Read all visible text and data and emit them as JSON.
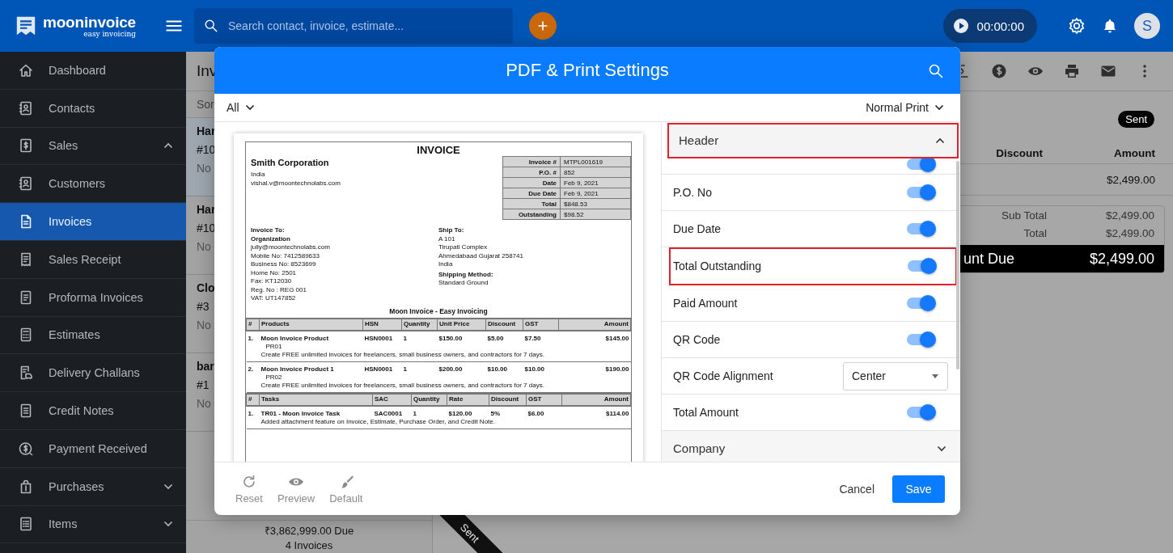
{
  "topbar": {
    "logo_name": "mooninvoice",
    "logo_tagline": "easy invoicing",
    "search_placeholder": "Search contact, invoice, estimate...",
    "timer": "00:00:00",
    "avatar": "S"
  },
  "sidebar": {
    "items": [
      {
        "kind": "link",
        "label": "Dashboard",
        "selected": false
      },
      {
        "kind": "link",
        "label": "Contacts",
        "selected": false
      },
      {
        "kind": "group",
        "label": "Sales",
        "selected": false,
        "expanded": true
      },
      {
        "kind": "link",
        "label": "Customers",
        "selected": false
      },
      {
        "kind": "link",
        "label": "Invoices",
        "selected": true
      },
      {
        "kind": "link",
        "label": "Sales Receipt",
        "selected": false
      },
      {
        "kind": "link",
        "label": "Proforma Invoices",
        "selected": false
      },
      {
        "kind": "link",
        "label": "Estimates",
        "selected": false
      },
      {
        "kind": "link",
        "label": "Delivery Challans",
        "selected": false
      },
      {
        "kind": "link",
        "label": "Credit Notes",
        "selected": false
      },
      {
        "kind": "link",
        "label": "Payment Received",
        "selected": false
      },
      {
        "kind": "group",
        "label": "Purchases",
        "selected": false,
        "expanded": false
      },
      {
        "kind": "group",
        "label": "Items",
        "selected": false,
        "expanded": false
      }
    ]
  },
  "list": {
    "title": "Inv",
    "sort": "Sor",
    "items": [
      {
        "name": "Har",
        "number": "#10",
        "status": "No",
        "selected": true
      },
      {
        "name": "Har",
        "number": "#10",
        "status": "No",
        "selected": false
      },
      {
        "name": "Clo",
        "number": "#3",
        "status": "No",
        "selected": false
      },
      {
        "name": "bar",
        "number": "#1",
        "status": "No",
        "selected": false
      }
    ],
    "total_due": "₹3,862,999.00 Due",
    "count": "4 Invoices"
  },
  "detail": {
    "status_badge": "Sent",
    "columns": [
      "Discount",
      "Amount"
    ],
    "row": [
      "$2,499.00"
    ],
    "totals": [
      {
        "label": "Sub Total",
        "value": "$2,499.00"
      },
      {
        "label": "Total",
        "value": "$2,499.00"
      }
    ],
    "amount_due": {
      "label": "unt Due",
      "value": "$2,499.00"
    },
    "ribbon": "Sent"
  },
  "modal": {
    "title": "PDF & Print Settings",
    "filter": "All",
    "print_mode": "Normal Print",
    "sections": [
      {
        "title": "Header",
        "expanded": true,
        "highlighted": true,
        "rows": [
          {
            "kind": "partial",
            "on": true
          },
          {
            "kind": "toggle",
            "label": "P.O. No",
            "on": true,
            "highlighted": false
          },
          {
            "kind": "toggle",
            "label": "Due Date",
            "on": true,
            "highlighted": false
          },
          {
            "kind": "toggle",
            "label": "Total Outstanding",
            "on": true,
            "highlighted": true
          },
          {
            "kind": "toggle",
            "label": "Paid Amount",
            "on": true,
            "highlighted": false
          },
          {
            "kind": "toggle",
            "label": "QR Code",
            "on": true,
            "highlighted": false
          },
          {
            "kind": "select",
            "label": "QR Code Alignment",
            "value": "Center",
            "highlighted": false
          },
          {
            "kind": "toggle",
            "label": "Total Amount",
            "on": true,
            "highlighted": false
          }
        ]
      },
      {
        "title": "Company",
        "expanded": false,
        "highlighted": false
      }
    ],
    "tools": [
      "Reset",
      "Preview",
      "Default"
    ],
    "cancel": "Cancel",
    "save": "Save"
  },
  "preview": {
    "title": "INVOICE",
    "company": "Smith Corporation",
    "company_lines": [
      "India",
      "vishal.v@moontechnolabs.com"
    ],
    "meta": [
      {
        "label": "Invoice #",
        "value": "MTPL001619"
      },
      {
        "label": "P.O. #",
        "value": "852"
      },
      {
        "label": "Date",
        "value": "Feb 9, 2021"
      },
      {
        "label": "Due Date",
        "value": "Feb 9, 2021"
      },
      {
        "label": "Total",
        "value": "$848.53"
      },
      {
        "label": "Outstanding",
        "value": "$98.52"
      }
    ],
    "bill_to": {
      "heading": "Invoice To:",
      "name": "Organization",
      "lines": [
        "jully@moontechnolabs.com",
        "Mobile No: 7412589633",
        "Business No: 8523699",
        "Home No: 2501",
        "Fax: KT12030",
        "Reg. No : REG 001",
        "VAT: UT147852"
      ]
    },
    "ship_to": {
      "heading": "Ship To:",
      "lines": [
        "A 101",
        "Tirupati Complex",
        "Ahmedabaad Gujarat 258741",
        "India"
      ],
      "method_heading": "Shipping Method:",
      "method": "Standard Ground"
    },
    "tagline": "Moon Invoice - Easy Invoicing",
    "products": {
      "columns": [
        "#",
        "Products",
        "HSN",
        "Quantity",
        "Unit Price",
        "Discount",
        "GST",
        "Amount"
      ],
      "rows": [
        {
          "cells": [
            "1.",
            "Moon Invoice Product",
            "HSN0001",
            "1",
            "$150.00",
            "$5.00",
            "$7.50",
            "$145.00"
          ],
          "code": "PR01",
          "description": "Create FREE unlimited invoices for freelancers, small business owners, and contractors for 7 days."
        },
        {
          "cells": [
            "2.",
            "Moon Invoice Product 1",
            "HSN0001",
            "1",
            "$200.00",
            "$10.00",
            "$10.00",
            "$190.00"
          ],
          "code": "PR02",
          "description": "Create FREE unlimited invoices for freelancers, small business owners, and contractors for 7 days."
        }
      ]
    },
    "tasks": {
      "columns": [
        "#",
        "Tasks",
        "SAC",
        "Quantity",
        "Rate",
        "Discount",
        "GST",
        "Amount"
      ],
      "rows": [
        {
          "cells": [
            "1.",
            "TR01 - Moon Invoice Task",
            "SAC0001",
            "1",
            "$120.00",
            "5%",
            "$6.00",
            "$114.00"
          ],
          "description": "Added attachment feature on Invoice, Estimate, Purchase Order, and Credit Note."
        }
      ]
    }
  }
}
